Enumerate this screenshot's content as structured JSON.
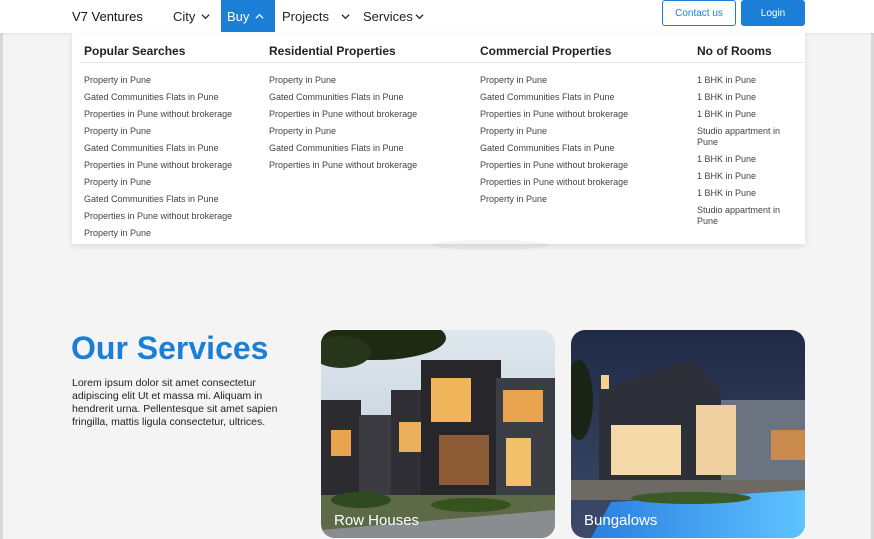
{
  "brand": "V7 Ventures",
  "nav": {
    "city": "City",
    "buy": "Buy",
    "projects": "Projects",
    "services": "Services",
    "contact": "Contact us",
    "login": "Login"
  },
  "mega_menu": {
    "columns": [
      {
        "title": "Popular Searches",
        "items": [
          "Property in Pune",
          "Gated Communities Flats in Pune",
          "Properties in Pune without brokerage",
          "Property in Pune",
          "Gated Communities Flats in Pune",
          "Properties in Pune without brokerage",
          "Property in Pune",
          "Gated Communities Flats in Pune",
          "Properties in Pune without brokerage",
          "Property in Pune"
        ]
      },
      {
        "title": "Residential Properties",
        "items": [
          "Property in Pune",
          "Gated Communities Flats in Pune",
          "Properties in Pune without brokerage",
          "Property in Pune",
          "Gated Communities Flats in Pune",
          "Properties in Pune without brokerage"
        ]
      },
      {
        "title": "Commercial Properties",
        "items": [
          "Property in Pune",
          "Gated Communities Flats in Pune",
          "Properties in Pune without brokerage",
          "Property in Pune",
          "Gated Communities Flats in Pune",
          "Properties in Pune without brokerage",
          "Properties in Pune without brokerage",
          "Property in Pune"
        ]
      },
      {
        "title": "No of Rooms",
        "items": [
          "1 BHK in Pune",
          "1 BHK in Pune",
          "1 BHK in Pune",
          "Studio appartment in Pune",
          "1 BHK in Pune",
          "1 BHK in Pune",
          "1 BHK in Pune",
          "Studio appartment in Pune"
        ]
      }
    ]
  },
  "services": {
    "title": "Our Services",
    "description": "Lorem ipsum dolor sit amet consectetur adipiscing elit Ut et massa mi. Aliquam in hendrerit urna. Pellentesque sit amet sapien fringilla, mattis ligula consectetur, ultrices.",
    "cards": [
      {
        "label": "Row Houses"
      },
      {
        "label": "Bungalows"
      }
    ]
  },
  "colors": {
    "accent": "#1b7fd8",
    "background": "#f4f4f5"
  }
}
